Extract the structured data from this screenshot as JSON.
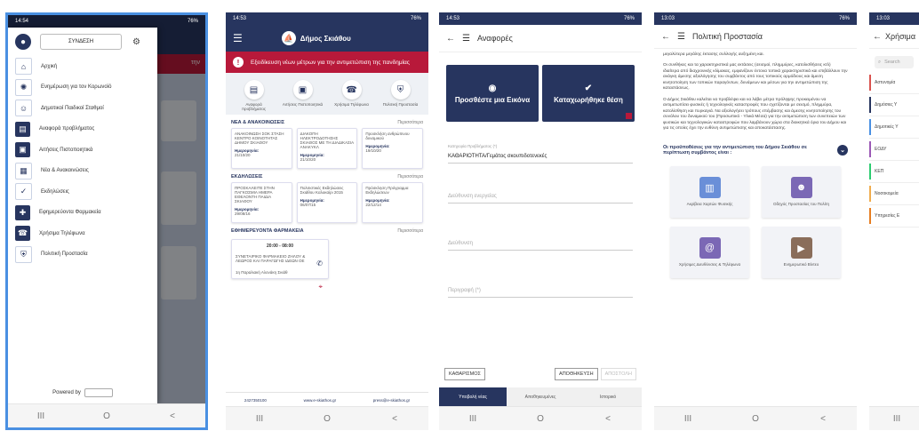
{
  "status_bar": {
    "time_1": "14:54",
    "time_2": "14:53",
    "time_3": "14:53",
    "time_4": "13:03",
    "time_5": "13:03",
    "battery": "76%"
  },
  "nav_keys": {
    "recent": "III",
    "home": "O",
    "back": "<"
  },
  "colors": {
    "brand": "#27355f",
    "alert": "#b8193a",
    "highlight": "#4a90e2"
  },
  "screen1": {
    "login_label": "ΣΥΝΔΕΣΗ",
    "bg_badge": "την",
    "menu": [
      {
        "label": "Αρχική",
        "icon": "home-icon",
        "color": "#ffffff"
      },
      {
        "label": "Ενημέρωση για τον Κορωνοϊό",
        "icon": "virus-icon",
        "color": "#ffffff"
      },
      {
        "label": "Δημοτικοί Παιδικοί Σταθμοί",
        "icon": "children-icon",
        "color": "#ffffff"
      },
      {
        "label": "Αναφορά προβλήματος",
        "icon": "report-icon",
        "color": "#27355f"
      },
      {
        "label": "Αιτήσεις Πιστοποιητικά",
        "icon": "certificate-icon",
        "color": "#27355f"
      },
      {
        "label": "Νέα & Ανακοινώσεις",
        "icon": "news-icon",
        "color": "#ffffff"
      },
      {
        "label": "Εκδηλώσεις",
        "icon": "calendar-icon",
        "color": "#ffffff"
      },
      {
        "label": "Εφημερεύοντα Φαρμακεία",
        "icon": "pharmacy-icon",
        "color": "#27355f"
      },
      {
        "label": "Χρήσιμα Τηλέφωνα",
        "icon": "phone-icon",
        "color": "#27355f"
      },
      {
        "label": "Πολιτική Προστασία",
        "icon": "shield-icon",
        "color": "#ffffff"
      }
    ],
    "powered_by": "Powered by"
  },
  "screen2": {
    "brand": "Δήμος Σκιάθου",
    "alert": "Εξειδίκευση νέων μέτρων για την αντιμετώπιση της πανδημίας",
    "quick": [
      "Αναφορά προβλήματος",
      "Αιτήσεις Πιστοποιητικά",
      "Χρήσιμα Τηλέφωνα",
      "Πολιτική Προστασία"
    ],
    "news_title": "ΝΕΑ & ΑΝΑΚΟΙΝΩΣΕΙΣ",
    "more": "Περισσότερα",
    "news": [
      {
        "text": "ΑΝΑΚΟΙΝΩΣΗ ΣΟΚ ΣΤΑΣΗ ΚΕΝΤΡΟ ΚΟΙΝΟΤΗΤΑΣ ΔΗΜΟΥ ΣΚΙΑΘΟΥ",
        "date_label": "Ημερομηνία:",
        "date": "21/10/20"
      },
      {
        "text": "ΔΙΑΚΟΠΗ ΗΛΕΚΤΡΟΔΟΤΗΣΗΣ ΣΚΙΑΘΟΣ ΜΕ ΤΗ ΔΙΑΔΙΚΑΣΙΑ ΑΝΑΚΥΚΛ",
        "date_label": "Ημερομηνία:",
        "date": "21/10/20"
      },
      {
        "text": "Προσκλήση ανθρώπινου δυναμικού",
        "date_label": "Ημερομηνία:",
        "date": "19/10/20"
      }
    ],
    "events_title": "ΕΚΔΗΛΩΣΕΙΣ",
    "events": [
      {
        "text": "ΠΡΟΣΚΑΛΕΙΤΕ ΣΤΗΝ ΠΑΓΚΟΣΜΙΑ ΗΜΕΡΑ ΕΘΕΛΟΝΤΗ ΠΑΙΔΙΑ ΣΚΙΑΘΟΥ",
        "date_label": "Ημερομηνία:",
        "date": "29/08/16"
      },
      {
        "text": "Πολιτιστικές Εκδηλώσεις Σκιάθου Καλοκαίρι 2015",
        "date_label": "Ημερομηνία:",
        "date": "06/07/15"
      },
      {
        "text": "Πρόσκληση Πρόγραμμα Εκδηλώσεων",
        "date_label": "Ημερομηνία:",
        "date": "22/12/14"
      }
    ],
    "pharm_title": "ΕΦΗΜΕΡΕΥΟΝΤΑ ΦΑΡΜΑΚΕΙΑ",
    "pharm_hours": "20:00 - 08:00",
    "pharm_name": "ΣΥΝΕΤΑΙΡΙΚΟ ΦΑΡΜΑΚΕΙΟ ΖΗΛΟΥ & ΛΕΩΡΟΣ ΚΑΙ ΠΑΡΑΓΩΓΗΣ ΙΔΕΩΝ ΟΕ",
    "pharm_addr": "1η Παραλιακή Αλονάκη Σκιάθ",
    "foot": [
      "2427350100",
      "www.e-skiathos.gr",
      "press@e-skiathos.gr"
    ]
  },
  "screen3": {
    "title": "Αναφορές",
    "btn_photo": "Προσθέστε μια Εικόνα",
    "btn_location": "Καταχωρήθηκε θέση",
    "category_label": "Κατηγορία Προβλήματος (*)",
    "category_value": "ΚΑΘΑΡΙΟΤΗΤΑ/Γεμάτος σκουπιδοτενεκές",
    "field_address": "Διεύθυνση ενεργείας",
    "field_location": "Διεύθυνση",
    "field_desc": "Περιγραφή (*)",
    "btn_clear": "ΚΑΘΑΡΙΣΜΟΣ",
    "btn_save": "ΑΠΟΘΗΚΕΥΣΗ",
    "btn_send": "ΑΠΟΣΤΟΛΗ",
    "tabs": [
      "Υποβολή νέας",
      "Αποθηκευμένες",
      "Ιστορικό"
    ]
  },
  "screen4": {
    "title": "Πολιτική Προστασία",
    "para0": "μεγαλύτερα μεγάλης έκτασης συλλογής αυξημένη και.",
    "para1": "Οι συνθήκες και τα χαρακτηριστικά μας εκτάσεις (σεισμοί, πλημμύρες, κατολισθήσεις κτλ) ιδιαίτερα από διαχρονικής κλίμακας, εμφανίζουν έντονα τοπικά χαρακτηριστικά και επιβάλλουν την ανάγκη άμεσης αξιολόγησης του συμβάντος από τους τοπικούς αρμόδιους και άμεση κινητοποίηση των τοπικών παραγόντων, δυνάμεων και μέσων για την αντιμετώπιση της καταστάσεως.",
    "para2": "Ο Δήμος Σκιάθου καλείται να προβλέψει και να λάβει μέτρα πρόληψης προκειμένου να αντιμετωπίσει φυσικές ή τεχνολογικές καταστροφές που σχετίζονται με σεισμό, πλημμύρα, κατολίσθηση και πυρκαγιά. Να αξιολογήσει τρόπους επέμβασης και άμεσης κινητοποίησης του συνόλου του δυναμικού του (Προσωπικό - Υλικά Μέσα) για την αντιμετώπιση των συνεπειών των φυσικών και τεχνολογικών καταστροφών που λαμβάνουν χώρα στα διοικητικά όρια του Δήμου και για τις οποίες έχει την ευθύνη αντιμετώπισης και αποκατάστασης.",
    "section": "Οι προϋποθέσεις για την αντιμετώπιση του Δήμου Σκιάθου σε περίπτωση συμβάντος είναι :",
    "tiles": [
      {
        "label": "Ακρίβεια Χαρτών Φυσικής",
        "icon": "building-icon",
        "color": "#6a8fd8"
      },
      {
        "label": "Οδηγός Προστασίας του Πολίτη",
        "icon": "person-icon",
        "color": "#7b68b5"
      },
      {
        "label": "Χρήσιμες Διευθύνσεις & Τηλέφωνα",
        "icon": "phonebook-icon",
        "color": "#7b68b5"
      },
      {
        "label": "Ενημερωτικό Βίντεο",
        "icon": "video-icon",
        "color": "#8a6d5a"
      }
    ]
  },
  "screen5": {
    "title": "Χρήσιμα",
    "search": "Search",
    "items": [
      {
        "label": "Αστυνομία",
        "color": "#d9534f"
      },
      {
        "label": "Δημόσιες Υ",
        "color": "#27355f"
      },
      {
        "label": "Δημοτικές Υ",
        "color": "#4a90e2"
      },
      {
        "label": "ΕΟΔΥ",
        "color": "#9b59b6"
      },
      {
        "label": "ΚΕΠ",
        "color": "#2ecc71"
      },
      {
        "label": "Νοσοκομεία",
        "color": "#f0ad4e"
      },
      {
        "label": "Υπηρεσίες Ε",
        "color": "#e67e22"
      }
    ]
  }
}
